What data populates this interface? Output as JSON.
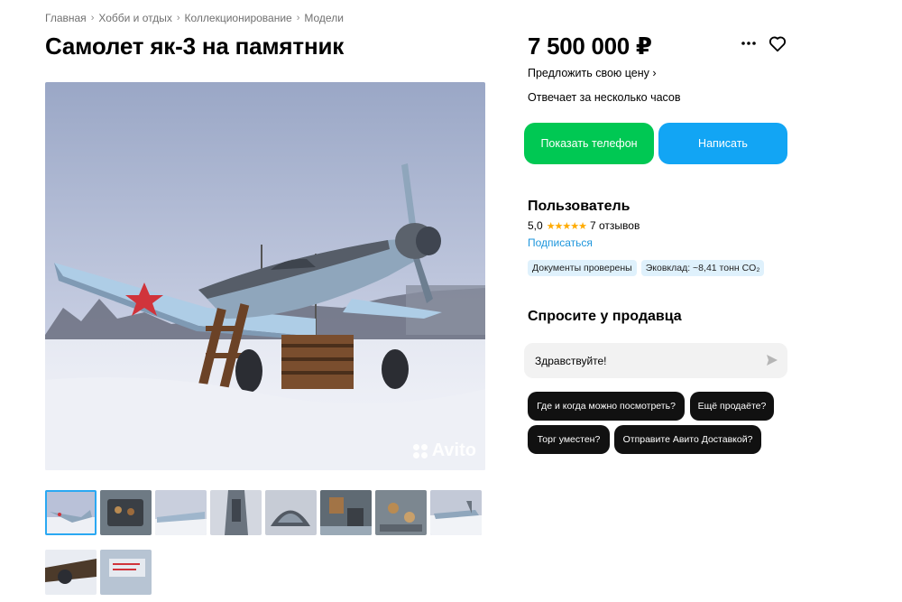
{
  "breadcrumb": [
    "Главная",
    "Хобби и отдых",
    "Коллекционирование",
    "Модели"
  ],
  "title": "Самолет як-3 на памятник",
  "price": "7 500 000 ₽",
  "offer_price": "Предложить свою цену ›",
  "response_time": "Отвечает за несколько часов",
  "buttons": {
    "phone": "Показать телефон",
    "write": "Написать"
  },
  "seller": {
    "name": "Пользователь",
    "rating": "5,0",
    "stars": "★★★★★",
    "reviews": "7 отзывов",
    "subscribe": "Подписаться",
    "badges": [
      "Документы проверены",
      "Эковклад: ~8,41 тонн CO₂"
    ]
  },
  "ask": {
    "title": "Спросите у продавца",
    "message": "Здравствуйте!",
    "chips": [
      "Где и когда можно посмотреть?",
      "Ещё продаёте?",
      "Торг уместен?",
      "Отправите Авито Доставкой?"
    ]
  },
  "watermark": "Avito",
  "icons": {
    "more": "more-dots-icon",
    "favorite": "heart-icon",
    "send": "send-icon"
  },
  "colors": {
    "phone_button": "#00c853",
    "write_button": "#12a5f4",
    "link": "#1e96dc",
    "star": "#ffab00",
    "thumb_active": "#2aa8f2"
  }
}
